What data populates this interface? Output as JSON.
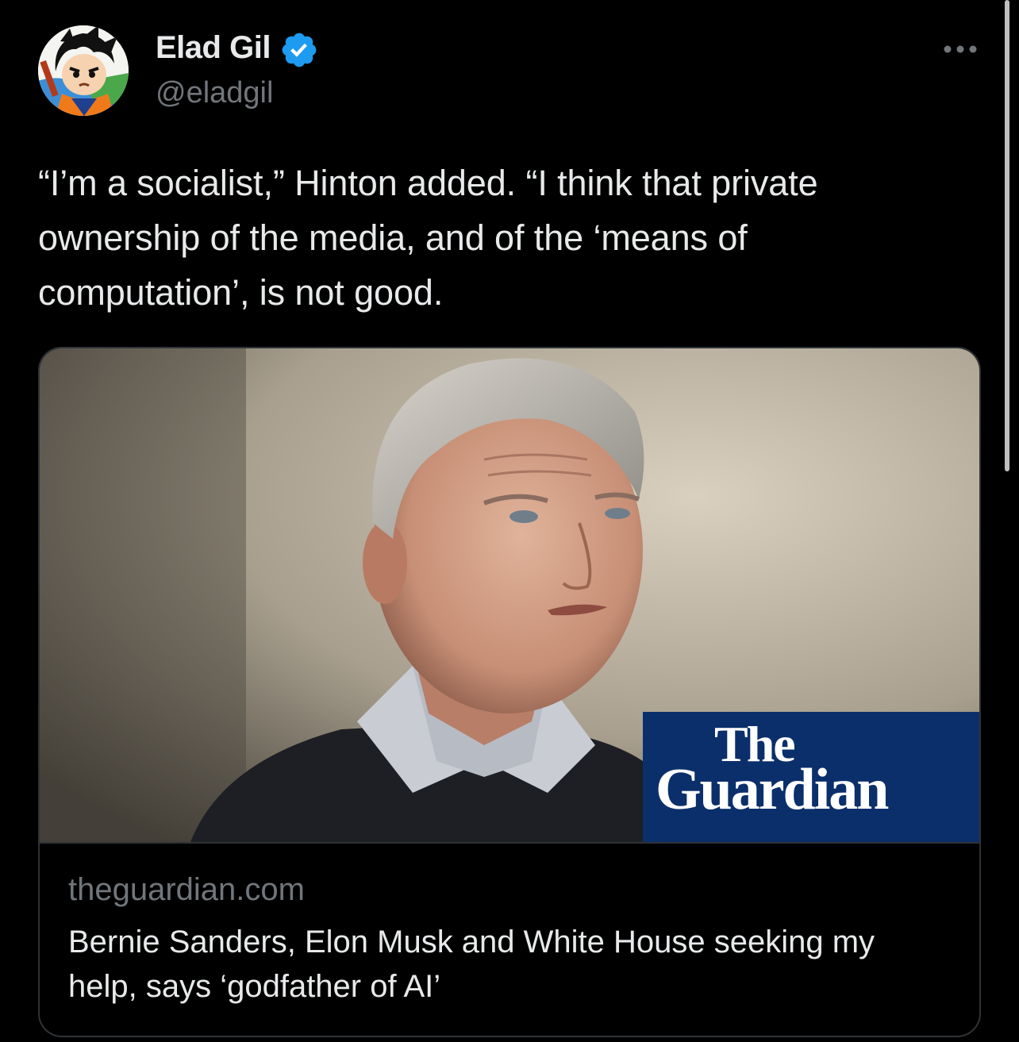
{
  "tweet": {
    "author": {
      "name": "Elad Gil",
      "handle": "@eladgil",
      "verified": true,
      "avatar": "cartoon-avatar"
    },
    "text": "“I’m a socialist,” Hinton added. “I think that private ownership of the media, and of the ‘means of computation’, is not good.",
    "card": {
      "image": "portrait-photo",
      "logo": {
        "line1": "The",
        "line2": "Guardian"
      },
      "domain": "theguardian.com",
      "title": "Bernie Sanders, Elon Musk and White House seeking my help, says ‘godfather of AI’"
    }
  },
  "icons": {
    "verified": "verified-badge-icon",
    "more": "more-options-icon"
  },
  "colors": {
    "background": "#000000",
    "text_primary": "#e7e9ea",
    "text_secondary": "#71767b",
    "verified_blue": "#1d9bf0",
    "border": "#2f3336",
    "guardian_blue": "#0b2f6b"
  }
}
